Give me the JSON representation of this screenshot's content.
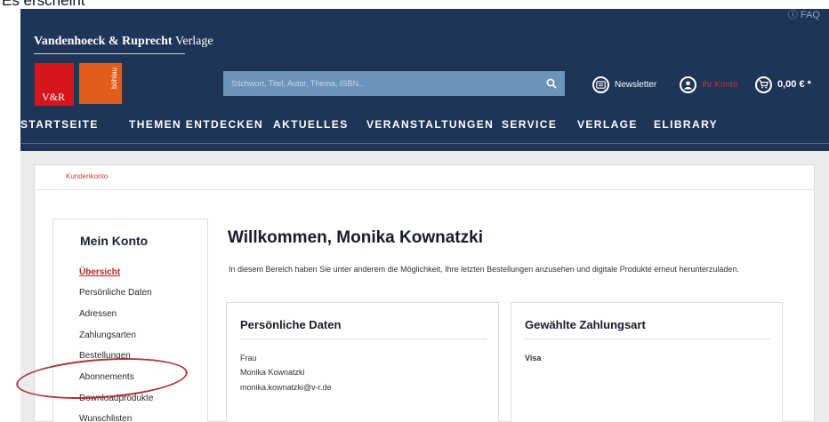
{
  "caption": "Es erscheint",
  "header": {
    "brand": {
      "bold": "Vandenhoeck & Ruprecht",
      "rest": "Verlage"
    },
    "logo_vr": "V&R",
    "logo_boehlau": "böhlau",
    "faq": "FAQ",
    "search_placeholder": "Stichwort, Titel, Autor, Thema, ISBN...",
    "newsletter": "Newsletter",
    "account": "Ihr Konto",
    "cart": "0,00 € *"
  },
  "nav": [
    "STARTSEITE",
    "THEMEN ENTDECKEN",
    "AKTUELLES",
    "VERANSTALTUNGEN",
    "SERVICE",
    "VERLAGE",
    "ELIBRARY"
  ],
  "breadcrumb": "Kundenkonto",
  "sidebar": {
    "title": "Mein Konto",
    "items": [
      "Übersicht",
      "Persönliche Daten",
      "Adressen",
      "Zahlungsarten",
      "Bestellungen",
      "Abonnements",
      "Downloadprodukte",
      "Wunschlisten"
    ]
  },
  "main": {
    "welcome": "Willkommen, Monika Kownatzki",
    "intro": "In diesem Bereich haben Sie unter anderem die Möglichkeit, Ihre letzten Bestellungen anzusehen und digitale Produkte erneut herunterzuladen.",
    "personal": {
      "title": "Persönliche Daten",
      "salutation": "Frau",
      "name": "Monika Kownatzki",
      "email": "monika.kownatzki@v-r.de"
    },
    "payment": {
      "title": "Gewählte Zahlungsart",
      "method": "Visa"
    }
  },
  "colors": {
    "header_bg": "#1e3557",
    "accent_red": "#d4161c",
    "accent_orange": "#e35d1a",
    "search_bg": "#6c93b9",
    "annotation": "#b1323a"
  }
}
